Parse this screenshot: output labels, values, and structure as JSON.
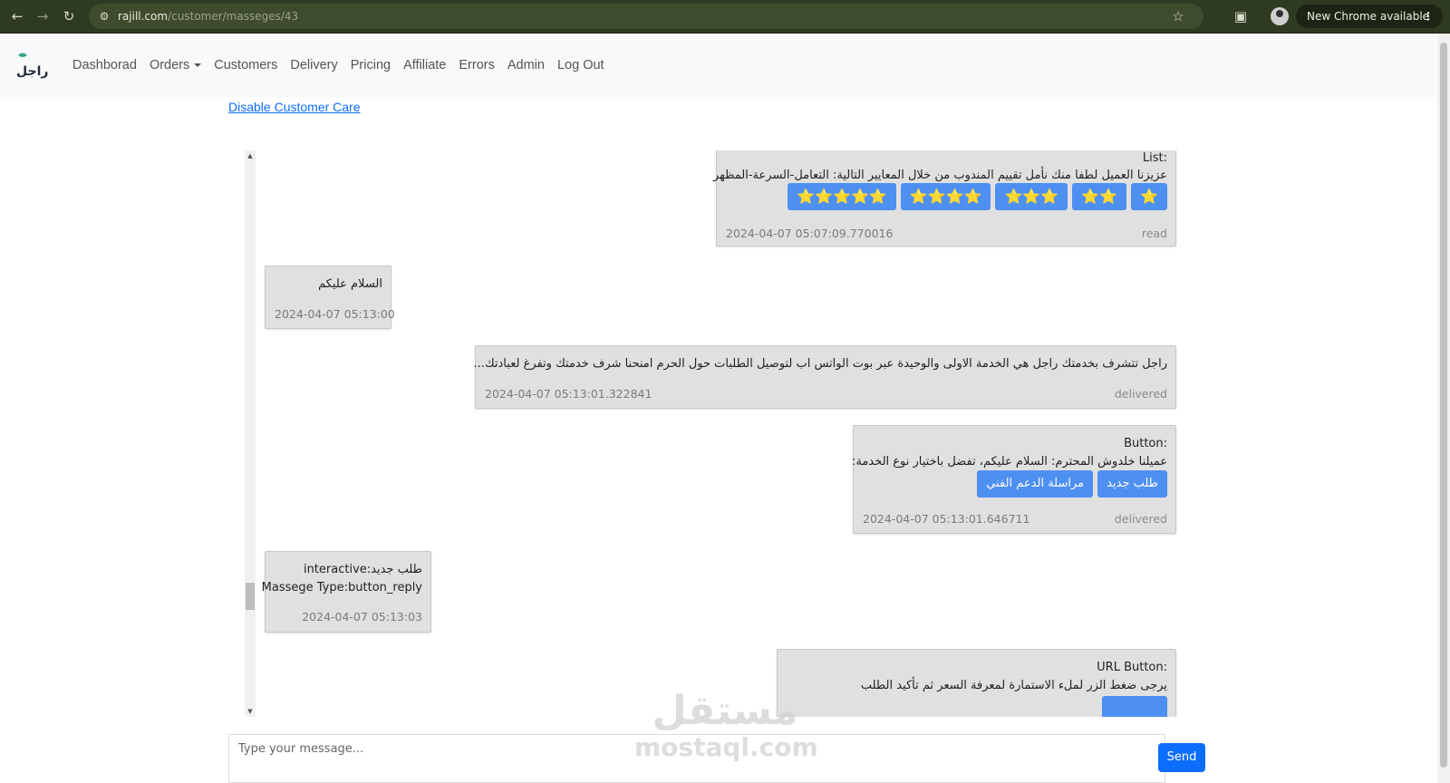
{
  "browser": {
    "url_host": "rajill.com",
    "url_path": "/customer/masseges/43",
    "update_label": "New Chrome available",
    "icons": [
      "back-icon",
      "forward-icon",
      "reload-icon",
      "site-settings-icon",
      "bookmark-star-icon",
      "extensions-icon",
      "profile-avatar"
    ]
  },
  "navbar": {
    "brand_text": "راجل",
    "items": [
      "Dashborad",
      "Orders",
      "Customers",
      "Delivery",
      "Pricing",
      "Affiliate",
      "Errors",
      "Admin",
      "Log Out"
    ]
  },
  "page": {
    "customer_care_link": "Disable Customer Care"
  },
  "messages": [
    {
      "direction": "out",
      "type_label": "List:",
      "text": "عزيزنا العميل لطفا منك نأمل تقييم المندوب من خلال المعايير التالية: التعامل-السرعة-المظهر",
      "buttons": [
        "⭐⭐⭐⭐⭐",
        "⭐⭐⭐⭐",
        "⭐⭐⭐",
        "⭐⭐",
        "⭐"
      ],
      "time": "2024-04-07 05:07:09.770016",
      "status": "read"
    },
    {
      "direction": "in",
      "text": "السلام عليكم",
      "time": "2024-04-07 05:13:00"
    },
    {
      "direction": "out",
      "text": "راجل تتشرف بخدمتك راجل هي الخدمة الاولى والوحيدة عبر بوت الواتس اب لتوصيل الطلبات حول الحرم امنحنا شرف خدمتك وتفرغ لعبادتك...",
      "time": "2024-04-07 05:13:01.322841",
      "status": "delivered"
    },
    {
      "direction": "out",
      "type_label": "Button:",
      "text": "عميلنا خلدوش المحترم: السلام عليكم، تفضل باختيار نوع الخدمة:",
      "buttons": [
        "طلب جديد",
        "مراسلة الدعم الفني"
      ],
      "time": "2024-04-07 05:13:01.646711",
      "status": "delivered"
    },
    {
      "direction": "in",
      "text": "interactive:طلب جديد",
      "subtext": "Massege Type:button_reply",
      "time": "2024-04-07 05:13:03"
    },
    {
      "direction": "out",
      "type_label": "URL Button:",
      "text": "يرجى ضغط الزر لملء الاستمارة لمعرفة السعر ثم تأكيد الطلب"
    }
  ],
  "composer": {
    "placeholder": "Type your message...",
    "send_label": "Send"
  },
  "watermark": {
    "arabic": "مستقل",
    "latin": "mostaql.com"
  }
}
